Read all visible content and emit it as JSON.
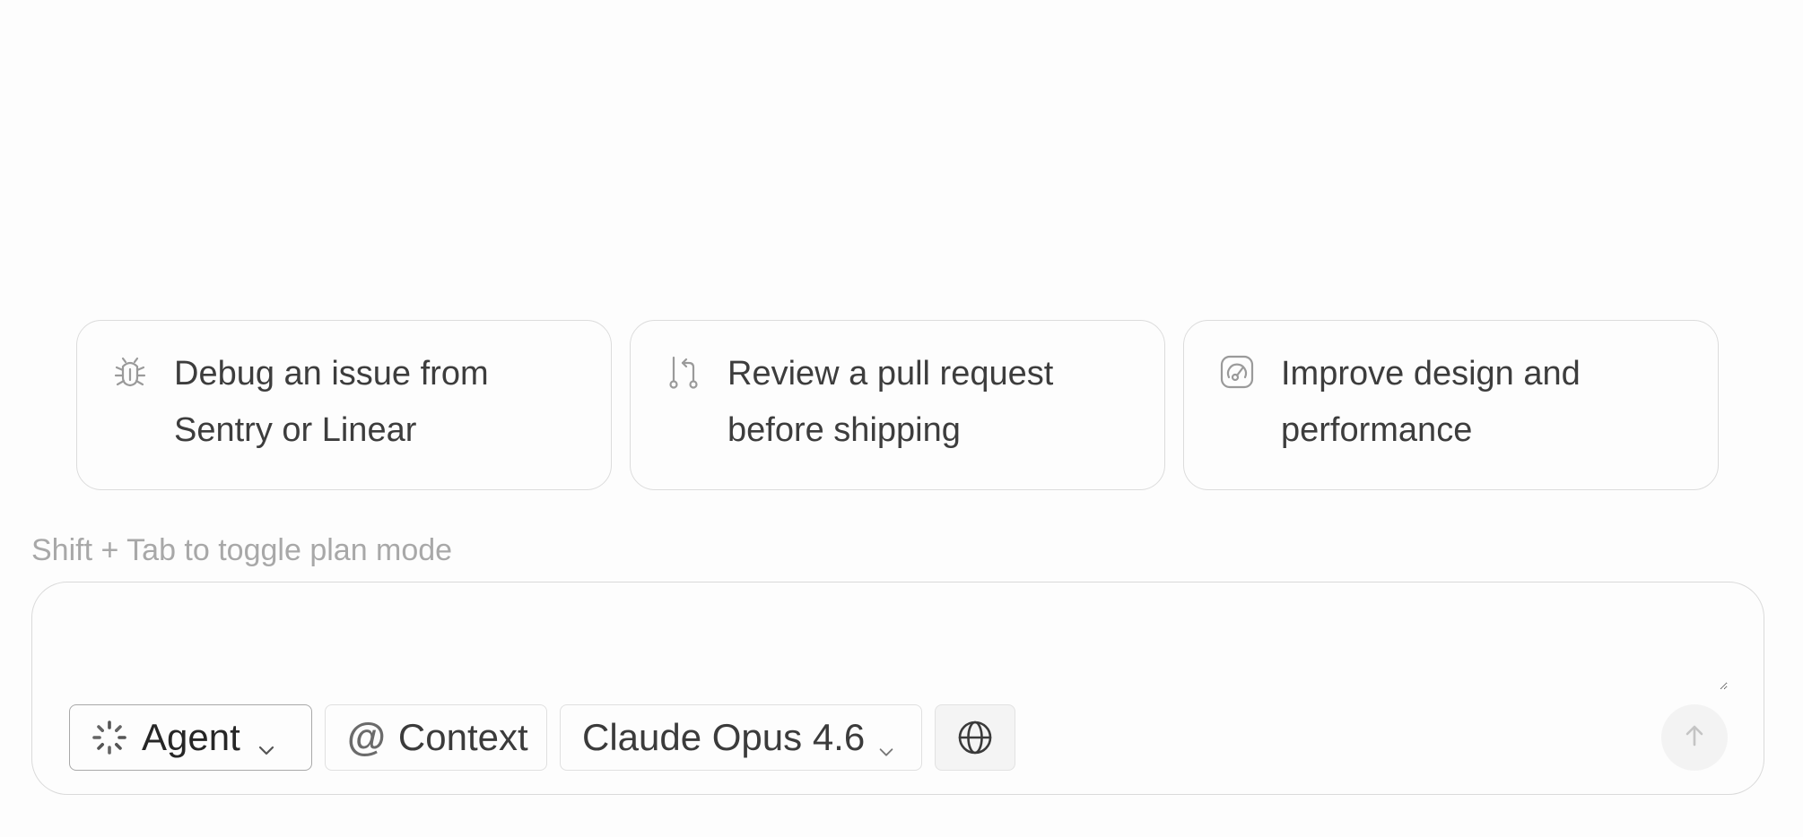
{
  "suggestions": [
    {
      "icon": "bug-icon",
      "text": "Debug an issue from Sentry or Linear"
    },
    {
      "icon": "pull-request-icon",
      "text": "Review a pull request before shipping"
    },
    {
      "icon": "gauge-icon",
      "text": "Improve design and performance"
    }
  ],
  "hint": "Shift + Tab to toggle plan mode",
  "composer": {
    "placeholder": "",
    "mode_label": "Agent",
    "context_symbol": "@",
    "context_label": "Context",
    "model_label": "Claude Opus 4.6",
    "web_icon": "globe-icon",
    "send_icon": "arrow-up-icon"
  },
  "colors": {
    "background": "#fdfdfd",
    "border": "#dcdcdc",
    "text": "#3d3d3d",
    "muted": "#a8a8a8"
  }
}
